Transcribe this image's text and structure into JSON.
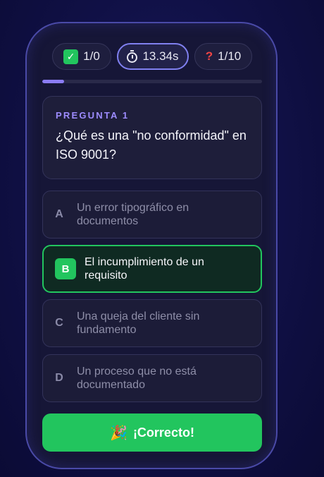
{
  "stats": {
    "score": "1/0",
    "time": "13.34s",
    "question_counter": "1/10",
    "question_mark": "?"
  },
  "progress": {
    "fraction": 0.1,
    "color": "#8b7cf6"
  },
  "question": {
    "label": "PREGUNTA 1",
    "text": "¿Qué es una \"no conformidad\" en ISO 9001?"
  },
  "options": [
    {
      "letter": "A",
      "text": "Un error tipográfico en documentos",
      "selected": false
    },
    {
      "letter": "B",
      "text": "El incumplimiento de un requisito",
      "selected": true
    },
    {
      "letter": "C",
      "text": "Una queja del cliente sin fundamento",
      "selected": false
    },
    {
      "letter": "D",
      "text": "Un proceso que no está documentado",
      "selected": false
    }
  ],
  "feedback": {
    "icon": "🎉",
    "text": "¡Correcto!"
  },
  "colors": {
    "success": "#22c55e",
    "accent": "#9d8cff",
    "error": "#ef4444"
  },
  "icons": {
    "score": "check-icon",
    "timer": "stopwatch-icon",
    "counter": "question-mark-icon",
    "feedback": "party-popper-icon"
  }
}
